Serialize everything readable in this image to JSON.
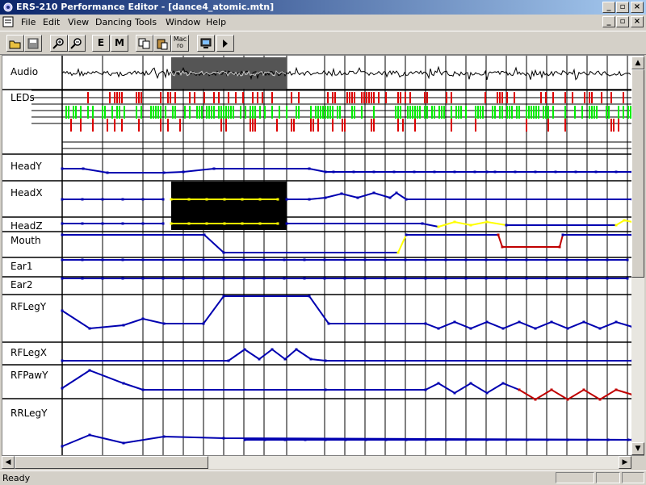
{
  "window": {
    "title": "ERS-210 Performance Editor - [dance4_atomic.mtn]"
  },
  "menu": [
    "File",
    "Edit",
    "View",
    "Dancing",
    "Tools",
    "Window",
    "Help"
  ],
  "toolbar": {
    "e_label": "E",
    "m_label": "M",
    "macro_label": "Mac ro"
  },
  "tracks": [
    "Audio",
    "LEDs",
    "HeadY",
    "HeadX",
    "HeadZ",
    "Mouth",
    "Ear1",
    "Ear2",
    "RFLegY",
    "RFLegX",
    "RFPawY",
    "RRLegY"
  ],
  "status": {
    "text": "Ready"
  },
  "colors": {
    "curve": "#0000b0",
    "selected_curve": "#ffff00",
    "highlight_curve": "#c00000",
    "led_red": "#dd0000",
    "led_green": "#00ee00",
    "selection": "#000000"
  }
}
